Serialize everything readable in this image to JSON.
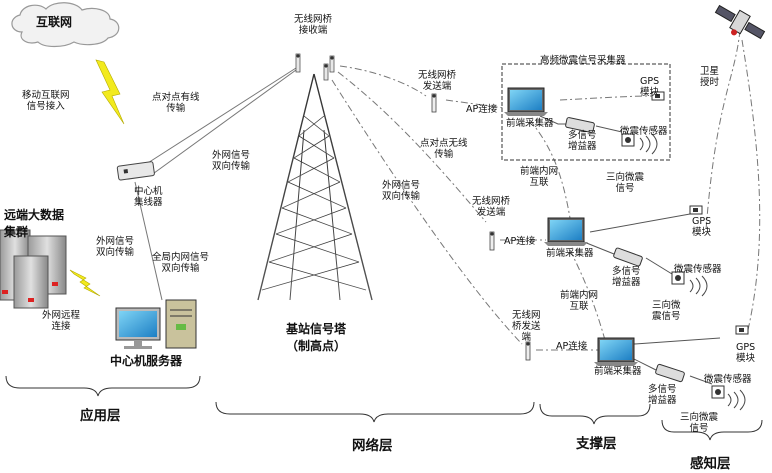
{
  "nodes": {
    "internet": "互联网",
    "mobile_access": "移动互联网\n信号接入",
    "hub": "中心机\n集线器",
    "datacenter": "远端大数据\n集群",
    "remote_link": "外网远程\n连接",
    "hub_server_link": "外网信号\n双向传输",
    "global_link": "全局内网信号\n双向传输",
    "server": "中心机服务器",
    "p2p_wired": "点对点有线\n传输",
    "hub_tower_link": "外网信号\n双向传输",
    "tower_receiver": "无线网桥\n接收端",
    "tower": "基站信号塔\n（制高点）",
    "p2p_wireless": "点对点无线\n传输",
    "tower_lower_link": "外网信号\n双向传输",
    "bridge_tx_1": "无线网桥\n发送端",
    "bridge_tx_2": "无线网桥\n发送端",
    "bridge_tx_3": "无线网\n桥发送\n端",
    "ap_link_1": "AP连接",
    "ap_link_2": "AP连接",
    "ap_link_3": "AP连接",
    "collector_box_title": "高频微震信号采集器",
    "collector": "前端采集器",
    "amplifier": "多信号\n增益器",
    "amplifier_2": "多信号\n增益器",
    "sensor": "微震传感器",
    "signal_3d": "三向微震\n信号",
    "signal_3d_2": "三向微\n震信号",
    "signal_3d_3": "三向微震\n信号",
    "gps": "GPS\n模块",
    "satellite": "卫星\n授时",
    "lan_link": "前端内网\n互联"
  },
  "layers": {
    "app": "应用层",
    "network": "网络层",
    "support": "支撑层",
    "sensing": "感知层"
  }
}
